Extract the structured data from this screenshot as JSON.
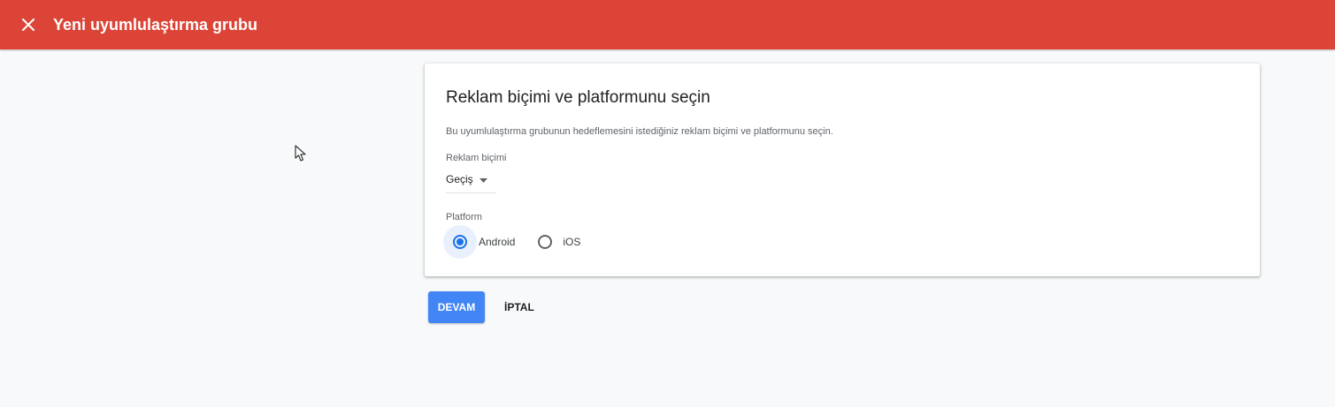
{
  "header": {
    "title": "Yeni uyumlulaştırma grubu",
    "close_icon": "close-icon",
    "background_color": "#db4437"
  },
  "card": {
    "title": "Reklam biçimi ve platformunu seçin",
    "description": "Bu uyumlulaştırma grubunun hedeflemesini istediğiniz reklam biçimi ve platformunu seçin.",
    "ad_format": {
      "label": "Reklam biçimi",
      "selected": "Geçiş",
      "arrow_icon": "dropdown-arrow-icon"
    },
    "platform": {
      "label": "Platform",
      "options": [
        {
          "label": "Android",
          "selected": true
        },
        {
          "label": "iOS",
          "selected": false
        }
      ],
      "accent_color": "#1a73e8"
    }
  },
  "actions": {
    "continue_label": "DEVAM",
    "cancel_label": "İPTAL",
    "primary_color": "#4285f4"
  }
}
